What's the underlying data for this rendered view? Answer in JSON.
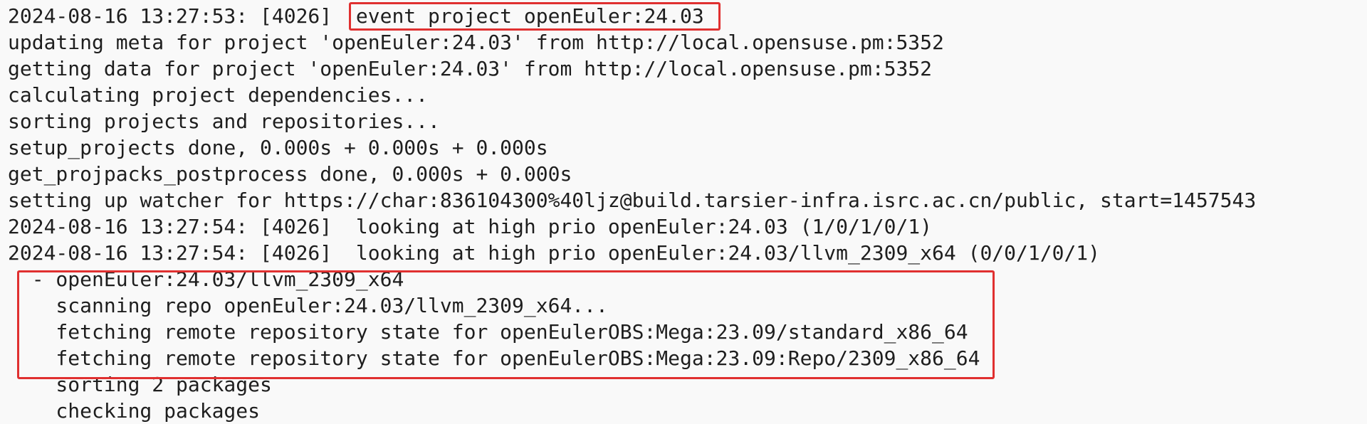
{
  "terminal": {
    "partial_line": "                                              ·         ·",
    "lines": [
      "2024-08-16 13:27:53: [4026]  event project openEuler:24.03",
      "updating meta for project 'openEuler:24.03' from http://local.opensuse.pm:5352",
      "getting data for project 'openEuler:24.03' from http://local.opensuse.pm:5352",
      "calculating project dependencies...",
      "sorting projects and repositories...",
      "setup_projects done, 0.000s + 0.000s + 0.000s",
      "get_projpacks_postprocess done, 0.000s + 0.000s",
      "setting up watcher for https://char:836104300%40ljz@build.tarsier-infra.isrc.ac.cn/public, start=1457543",
      "2024-08-16 13:27:54: [4026]  looking at high prio openEuler:24.03 (1/0/1/0/1)",
      "2024-08-16 13:27:54: [4026]  looking at high prio openEuler:24.03/llvm_2309_x64 (0/0/1/0/1)",
      "  - openEuler:24.03/llvm_2309_x64",
      "    scanning repo openEuler:24.03/llvm_2309_x64...",
      "    fetching remote repository state for openEulerOBS:Mega:23.09/standard_x86_64",
      "    fetching remote repository state for openEulerOBS:Mega:23.09:Repo/2309_x86_64",
      "    sorting 2 packages",
      "    checking packages"
    ]
  },
  "highlight_color": "#e03030",
  "text_color": "#1e1e1e",
  "background_color": "#f9f9f9"
}
